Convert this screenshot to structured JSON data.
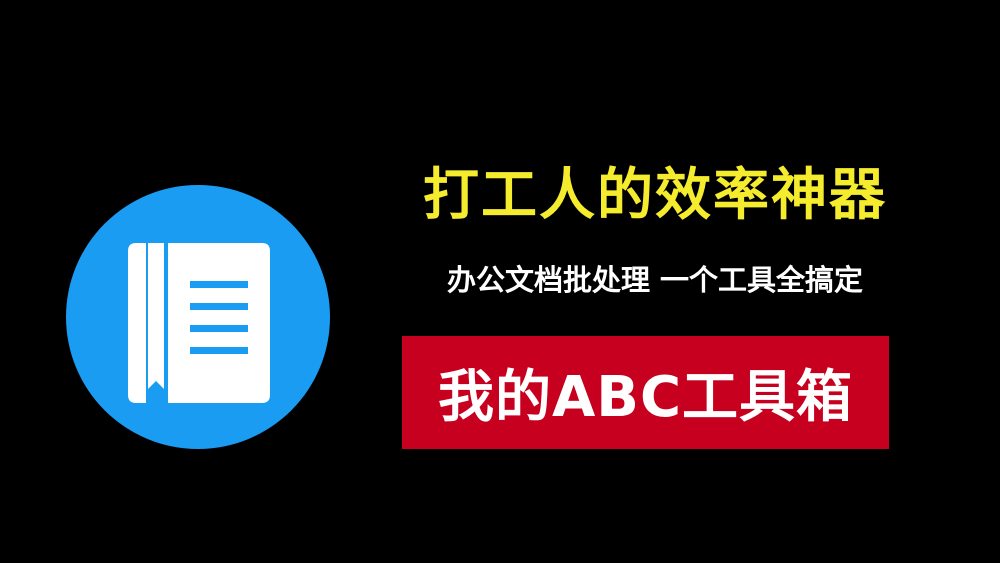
{
  "icon": {
    "name": "document-book-icon",
    "circle_color": "#1a9cf3",
    "glyph_color": "#ffffff"
  },
  "headline": "打工人的效率神器",
  "subheadline": "办公文档批处理  一个工具全搞定",
  "banner": {
    "text": "我的ABC工具箱",
    "color": "#c8001f"
  },
  "colors": {
    "background": "#000000",
    "headline": "#f5ec2e",
    "text": "#ffffff"
  }
}
